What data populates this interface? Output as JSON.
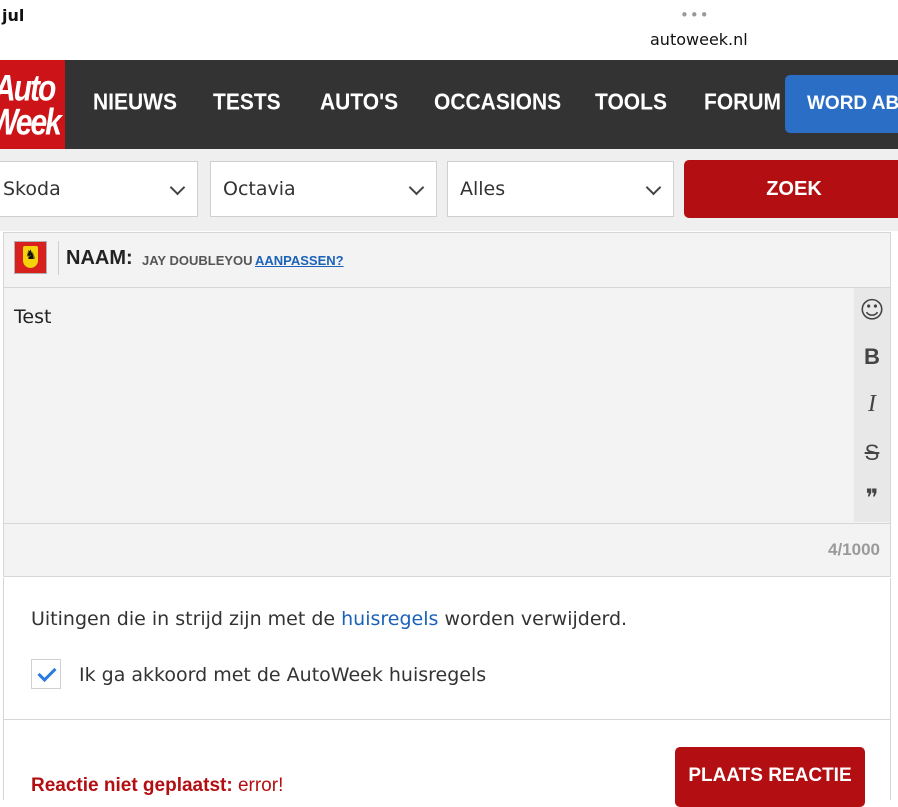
{
  "status": {
    "time": "jul",
    "dots": "•••",
    "url": "autoweek.nl"
  },
  "logo": {
    "line1": "Auto",
    "line2": "Week"
  },
  "nav": {
    "items": [
      "NIEUWS",
      "TESTS",
      "AUTO'S",
      "OCCASIONS",
      "TOOLS",
      "FORUM"
    ],
    "cta": "WORD ABONNEE"
  },
  "search": {
    "brand": "Skoda",
    "model": "Octavia",
    "type": "Alles",
    "button": "ZOEK"
  },
  "comment": {
    "name_label": "NAAM:",
    "name_value": "JAY DOUBLEYOU",
    "name_change": "AANPASSEN?",
    "text": "Test",
    "counter": "4/1000",
    "toolbar_icons": [
      "smiley-icon",
      "bold-icon",
      "italic-icon",
      "strikethrough-icon",
      "quote-icon"
    ],
    "toolbar_glyphs": {
      "smiley": "☺",
      "bold": "B",
      "italic": "I",
      "strike": "S",
      "quote": "❞"
    }
  },
  "rules": {
    "text_before": "Uitingen die in strijd zijn met de ",
    "link": "huisregels",
    "text_after": " worden verwijderd.",
    "agree_label": "Ik ga akkoord met de AutoWeek huisregels",
    "agree_checked": true
  },
  "submit": {
    "error_bold": "Reactie niet geplaatst:",
    "error_text": " error!",
    "button": "PLAATS REACTIE"
  },
  "colors": {
    "brand_red": "#b30f12",
    "logo_red": "#cc1418",
    "nav_bg": "#333333",
    "cta_blue": "#2a6fc5",
    "link_blue": "#1b62b8"
  }
}
